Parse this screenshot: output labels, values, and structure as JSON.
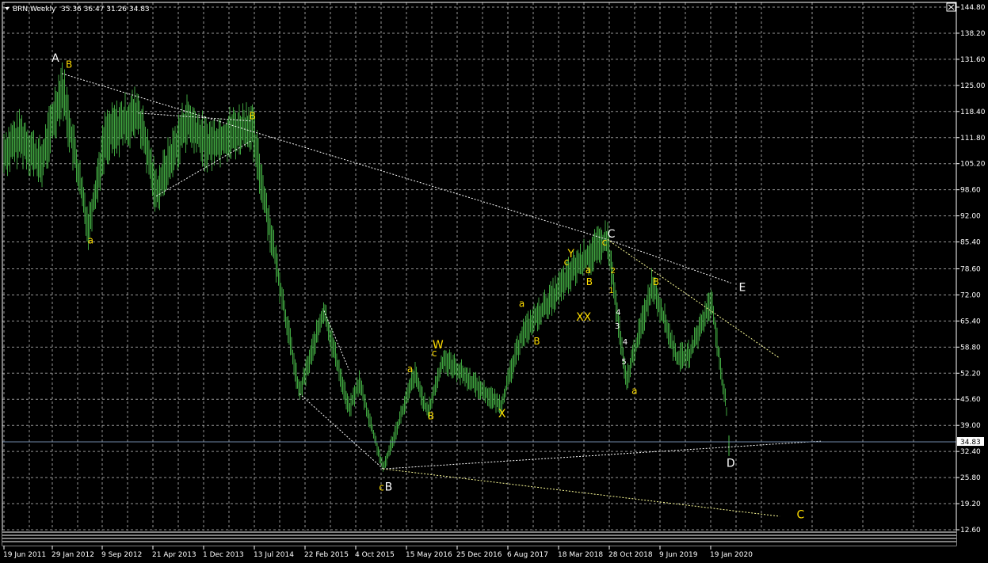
{
  "window": {
    "title": "BRN,Weekly",
    "ohlc": "35.36 36.47 31.26 34.83",
    "menu_arrow_icon": "triangle-down-icon",
    "close_icon": "close-box-icon"
  },
  "colors": {
    "background": "#000000",
    "grid": "#c8c8c8",
    "bars": "#3fa33f",
    "frame": "#ffffff",
    "wave_yellow": "#ffdd00",
    "wave_white": "#ffffff",
    "price_line": "#6f89a8",
    "trendline_white": "#ffffff",
    "trendline_yellow": "#ffff99"
  },
  "price_axis": {
    "ticks": [
      "144.80",
      "138.20",
      "131.60",
      "125.00",
      "118.40",
      "111.80",
      "105.20",
      "98.60",
      "92.00",
      "85.40",
      "78.60",
      "72.00",
      "65.40",
      "58.80",
      "52.20",
      "45.60",
      "39.00",
      "32.40",
      "25.80",
      "19.20",
      "12.60"
    ],
    "current_price_label": "34.83"
  },
  "time_axis": {
    "ticks": [
      "19 Jun 2011",
      "29 Jan 2012",
      "9 Sep 2012",
      "21 Apr 2013",
      "1 Dec 2013",
      "13 Jul 2014",
      "22 Feb 2015",
      "4 Oct 2015",
      "15 May 2016",
      "25 Dec 2016",
      "6 Aug 2017",
      "18 Mar 2018",
      "28 Oct 2018",
      "9 Jun 2019",
      "19 Jan 2020"
    ]
  },
  "chart_data": {
    "type": "bar",
    "symbol": "BRN",
    "timeframe": "Weekly",
    "ylim": [
      12.6,
      144.8
    ],
    "last_bar": {
      "open": 35.36,
      "high": 36.47,
      "low": 31.26,
      "close": 34.83
    },
    "close_path": [
      {
        "date": "2011-06-19",
        "price": 108
      },
      {
        "date": "2011-09-01",
        "price": 112
      },
      {
        "date": "2011-12-01",
        "price": 105
      },
      {
        "date": "2012-03-01",
        "price": 125
      },
      {
        "date": "2012-06-25",
        "price": 89
      },
      {
        "date": "2012-09-09",
        "price": 112
      },
      {
        "date": "2013-02-01",
        "price": 118
      },
      {
        "date": "2013-04-21",
        "price": 98
      },
      {
        "date": "2013-09-01",
        "price": 116
      },
      {
        "date": "2013-12-01",
        "price": 110
      },
      {
        "date": "2014-06-15",
        "price": 115
      },
      {
        "date": "2015-01-13",
        "price": 47
      },
      {
        "date": "2015-05-01",
        "price": 68
      },
      {
        "date": "2015-08-20",
        "price": 43
      },
      {
        "date": "2015-10-04",
        "price": 50
      },
      {
        "date": "2016-01-17",
        "price": 28
      },
      {
        "date": "2016-06-05",
        "price": 52
      },
      {
        "date": "2016-08-01",
        "price": 42
      },
      {
        "date": "2016-10-10",
        "price": 56
      },
      {
        "date": "2017-06-20",
        "price": 44
      },
      {
        "date": "2017-09-20",
        "price": 62
      },
      {
        "date": "2018-01-15",
        "price": 70
      },
      {
        "date": "2018-05-15",
        "price": 79
      },
      {
        "date": "2018-10-03",
        "price": 86
      },
      {
        "date": "2018-12-24",
        "price": 50
      },
      {
        "date": "2019-04-20",
        "price": 75
      },
      {
        "date": "2019-08-05",
        "price": 56
      },
      {
        "date": "2019-10-01",
        "price": 57
      },
      {
        "date": "2020-01-06",
        "price": 71
      },
      {
        "date": "2020-02-20",
        "price": 50
      },
      {
        "date": "2020-03-08",
        "price": 45
      },
      {
        "date": "2020-03-22",
        "price": 34.83
      }
    ],
    "trendlines": [
      {
        "color": "white",
        "from": {
          "date": "2012-03-01",
          "price": 128
        },
        "to": {
          "date": "2018-10-03",
          "price": 86
        }
      },
      {
        "color": "white",
        "from": {
          "date": "2018-10-03",
          "price": 86
        },
        "to": {
          "date": "2020-04-01",
          "price": 75
        }
      },
      {
        "color": "yellow",
        "from": {
          "date": "2018-10-03",
          "price": 86
        },
        "to": {
          "date": "2020-11-01",
          "price": 56
        }
      },
      {
        "color": "white",
        "from": {
          "date": "2016-01-17",
          "price": 28
        },
        "to": {
          "date": "2021-05-01",
          "price": 35
        }
      },
      {
        "color": "yellow",
        "from": {
          "date": "2016-01-17",
          "price": 28
        },
        "to": {
          "date": "2020-11-01",
          "price": 16
        }
      },
      {
        "color": "white",
        "from": {
          "date": "2013-04-21",
          "price": 97
        },
        "to": {
          "date": "2014-06-15",
          "price": 111
        }
      },
      {
        "color": "white",
        "from": {
          "date": "2013-02-01",
          "price": 118
        },
        "to": {
          "date": "2014-06-15",
          "price": 116
        }
      },
      {
        "color": "white",
        "from": {
          "date": "2015-01-13",
          "price": 47
        },
        "to": {
          "date": "2016-01-17",
          "price": 28
        }
      },
      {
        "color": "white",
        "from": {
          "date": "2015-05-01",
          "price": 68
        },
        "to": {
          "date": "2015-08-20",
          "price": 53
        }
      }
    ],
    "wave_labels": [
      {
        "text": "A",
        "color": "white",
        "date": "2012-02-01",
        "price": 131
      },
      {
        "text": "B",
        "color": "yellow",
        "date": "2012-04-01",
        "price": 129.5
      },
      {
        "text": "a",
        "color": "yellow",
        "date": "2012-07-05",
        "price": 85
      },
      {
        "text": "B",
        "color": "yellow",
        "date": "2014-06-20",
        "price": 116.5
      },
      {
        "text": "c",
        "color": "yellow",
        "date": "2016-01-10",
        "price": 22.5
      },
      {
        "text": "B",
        "color": "white",
        "date": "2016-02-10",
        "price": 22.5
      },
      {
        "text": "a",
        "color": "yellow",
        "date": "2016-05-15",
        "price": 52.5
      },
      {
        "text": "B",
        "color": "yellow",
        "date": "2016-08-15",
        "price": 40.5
      },
      {
        "text": "c",
        "color": "yellow",
        "date": "2016-08-30",
        "price": 56.5
      },
      {
        "text": "W",
        "color": "yellow",
        "date": "2016-09-15",
        "price": 58.5
      },
      {
        "text": "X",
        "color": "yellow",
        "date": "2017-06-25",
        "price": 41
      },
      {
        "text": "a",
        "color": "yellow",
        "date": "2017-09-20",
        "price": 69
      },
      {
        "text": "B",
        "color": "yellow",
        "date": "2017-11-25",
        "price": 59.5
      },
      {
        "text": "c",
        "color": "yellow",
        "date": "2018-04-05",
        "price": 79.5
      },
      {
        "text": "Y",
        "color": "yellow",
        "date": "2018-04-25",
        "price": 81.5
      },
      {
        "text": "a",
        "color": "yellow",
        "date": "2018-07-10",
        "price": 77.5
      },
      {
        "text": "B",
        "color": "yellow",
        "date": "2018-07-15",
        "price": 74.5
      },
      {
        "text": "XX",
        "color": "yellow",
        "date": "2018-06-20",
        "price": 65.5
      },
      {
        "text": "c",
        "color": "yellow",
        "date": "2018-09-20",
        "price": 84.5
      },
      {
        "text": "C",
        "color": "white",
        "date": "2018-10-20",
        "price": 86.5
      },
      {
        "text": "2",
        "color": "yellow",
        "date": "2018-10-28",
        "price": 77.5
      },
      {
        "text": "1",
        "color": "yellow",
        "date": "2018-10-20",
        "price": 72.5
      },
      {
        "text": "4",
        "color": "white",
        "date": "2018-11-20",
        "price": 67
      },
      {
        "text": "3",
        "color": "white",
        "date": "2018-11-15",
        "price": 63.5
      },
      {
        "text": "4",
        "color": "white",
        "date": "2018-12-20",
        "price": 59.5
      },
      {
        "text": "5",
        "color": "white",
        "date": "2018-12-15",
        "price": 54.5
      },
      {
        "text": "a",
        "color": "yellow",
        "date": "2019-01-30",
        "price": 47
      },
      {
        "text": "B",
        "color": "yellow",
        "date": "2019-05-05",
        "price": 74.5
      },
      {
        "text": "E",
        "color": "white",
        "date": "2020-05-20",
        "price": 73
      },
      {
        "text": "D",
        "color": "white",
        "date": "2020-03-30",
        "price": 28.5
      },
      {
        "text": "C",
        "color": "yellow",
        "date": "2021-02-01",
        "price": 15.5
      }
    ]
  }
}
